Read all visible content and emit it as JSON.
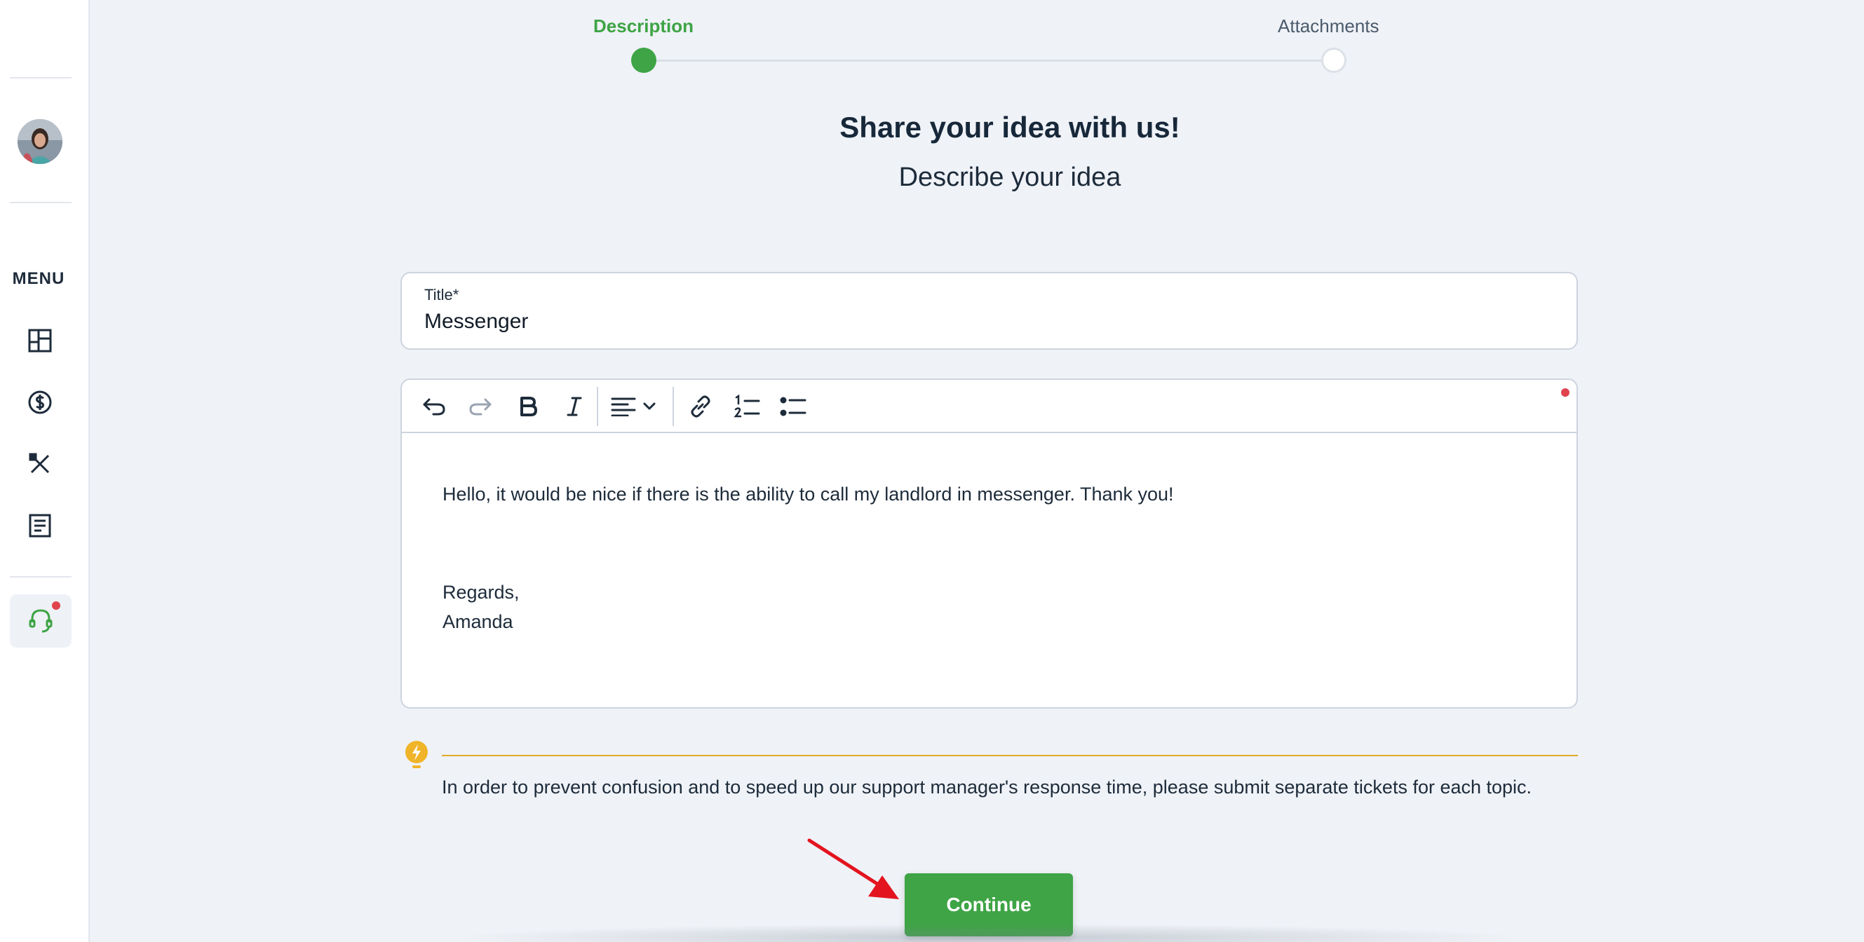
{
  "sidebar": {
    "menu_label": "MENU",
    "items": [
      {
        "name": "dashboard",
        "icon": "dashboard-icon"
      },
      {
        "name": "payments",
        "icon": "dollar-circle-icon"
      },
      {
        "name": "maintenance",
        "icon": "tools-icon"
      },
      {
        "name": "documents",
        "icon": "document-icon"
      },
      {
        "name": "support",
        "icon": "headset-icon",
        "active": true
      }
    ]
  },
  "stepper": {
    "steps": [
      {
        "label": "Description",
        "state": "active"
      },
      {
        "label": "Attachments",
        "state": "pending"
      }
    ]
  },
  "header": {
    "title": "Share your idea with us!",
    "subtitle": "Describe your idea"
  },
  "form": {
    "title_label": "Title*",
    "title_value": "Messenger",
    "body_lines": [
      "Hello, it would be nice if there is the ability to call my landlord in messenger. Thank you!",
      "Regards,",
      "Amanda"
    ]
  },
  "tip": {
    "text": "In order to prevent confusion and to speed up our support manager's response time, please submit separate tickets for each topic."
  },
  "actions": {
    "continue_label": "Continue"
  },
  "colors": {
    "accent": "#3ea445",
    "alert": "#e0434d",
    "tip": "#e3a92a",
    "annotation_arrow": "#e3141f"
  }
}
